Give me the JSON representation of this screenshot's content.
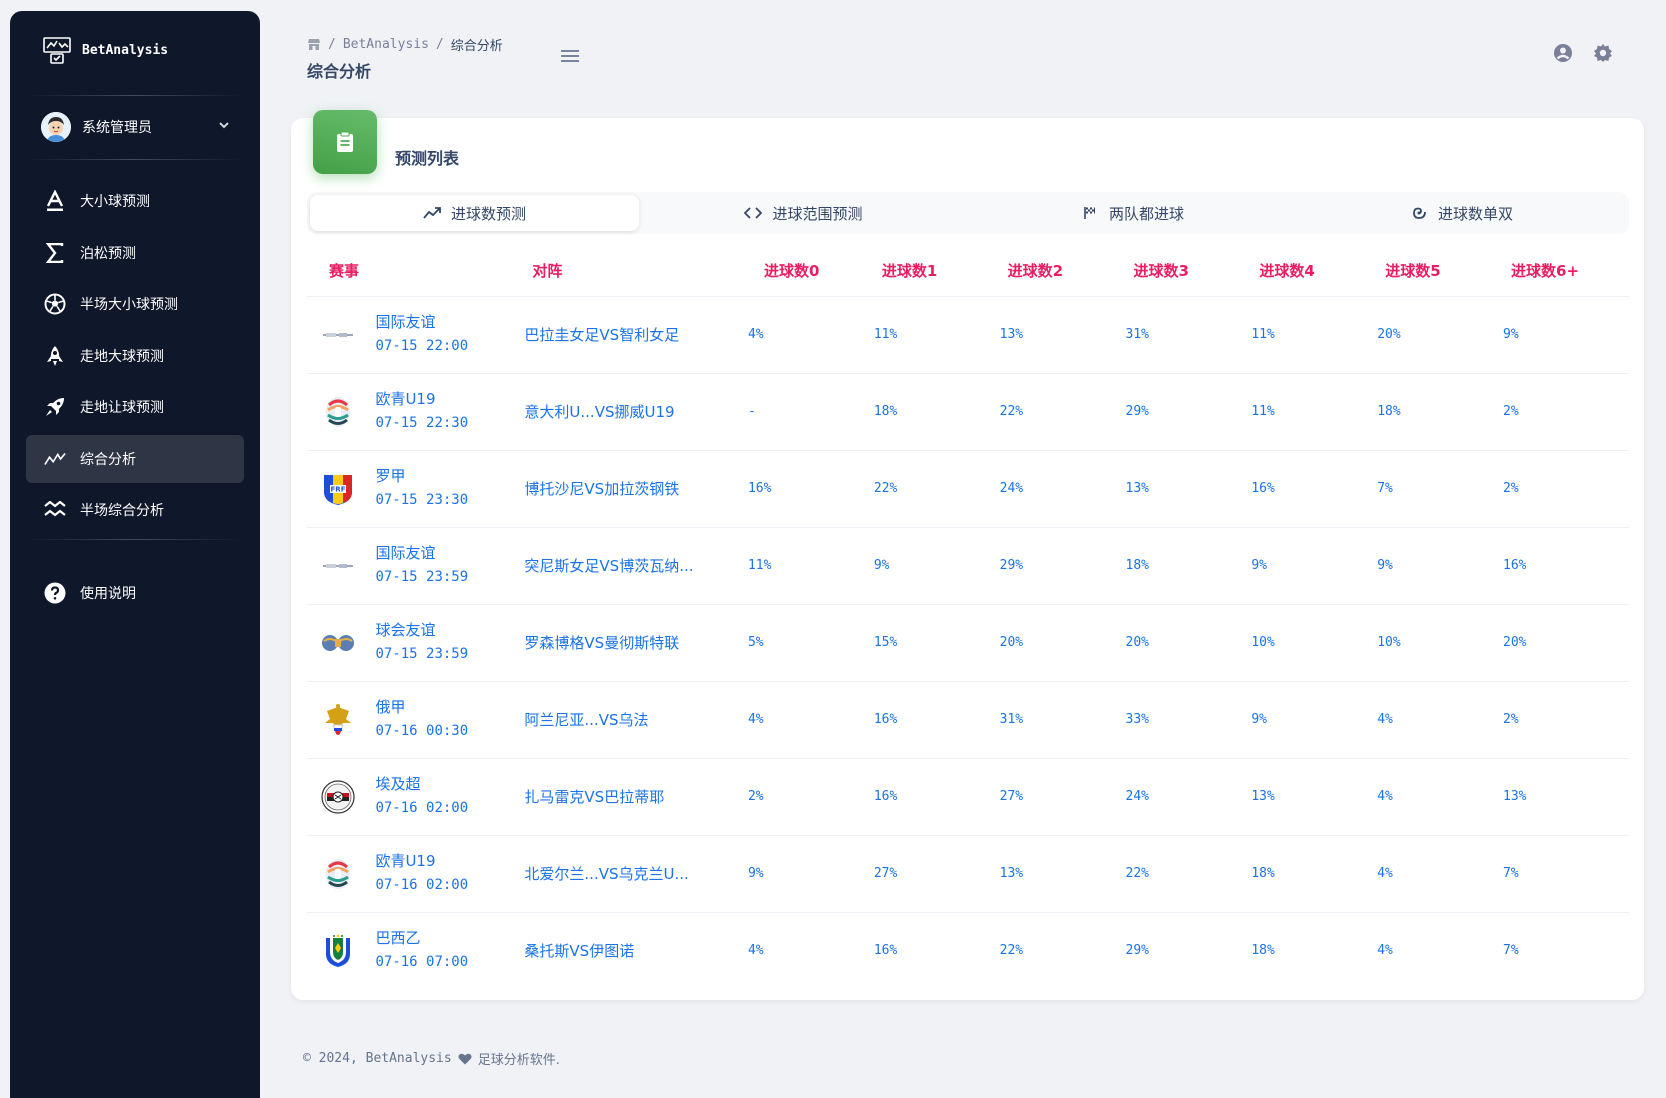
{
  "app": {
    "brand": "BetAnalysis"
  },
  "user": {
    "name": "系统管理员"
  },
  "sidebar": {
    "items": [
      {
        "label": "大小球预测",
        "icon": "letter-a-icon",
        "active": false
      },
      {
        "label": "泊松预测",
        "icon": "sigma-icon",
        "active": false
      },
      {
        "label": "半场大小球预测",
        "icon": "soccer-ball-icon",
        "active": false
      },
      {
        "label": "走地大球预测",
        "icon": "rocket-icon",
        "active": false
      },
      {
        "label": "走地让球预测",
        "icon": "rocket-launch-icon",
        "active": false
      },
      {
        "label": "综合分析",
        "icon": "trend-icon",
        "active": true
      },
      {
        "label": "半场综合分析",
        "icon": "waves-icon",
        "active": false
      }
    ],
    "help": {
      "label": "使用说明",
      "icon": "question-icon"
    }
  },
  "header": {
    "breadcrumb": {
      "root": "BetAnalysis",
      "current": "综合分析",
      "separator": "/"
    },
    "title": "综合分析"
  },
  "card": {
    "title": "预测列表",
    "tabs": [
      {
        "label": "进球数预测",
        "icon": "trend-icon",
        "active": true
      },
      {
        "label": "进球范围预测",
        "icon": "code-icon",
        "active": false
      },
      {
        "label": "两队都进球",
        "icon": "flag-icon",
        "active": false
      },
      {
        "label": "进球数单双",
        "icon": "spiral-icon",
        "active": false
      }
    ],
    "table": {
      "headers": [
        "赛事",
        "对阵",
        "进球数0",
        "进球数1",
        "进球数2",
        "进球数3",
        "进球数4",
        "进球数5",
        "进球数6+"
      ],
      "rows": [
        {
          "logo": "friendly-logo",
          "league": "国际友谊",
          "time": "07-15 22:00",
          "match": "巴拉圭女足VS智利女足",
          "p": [
            "4%",
            "11%",
            "13%",
            "31%",
            "11%",
            "20%",
            "9%"
          ]
        },
        {
          "logo": "euro-u19-logo",
          "league": "欧青U19",
          "time": "07-15 22:30",
          "match": "意大利U...VS挪威U19",
          "p": [
            "-",
            "18%",
            "22%",
            "29%",
            "11%",
            "18%",
            "2%"
          ]
        },
        {
          "logo": "romania-frf-logo",
          "league": "罗甲",
          "time": "07-15 23:30",
          "match": "博托沙尼VS加拉茨钢铁",
          "p": [
            "16%",
            "22%",
            "24%",
            "13%",
            "16%",
            "7%",
            "2%"
          ]
        },
        {
          "logo": "friendly-logo",
          "league": "国际友谊",
          "time": "07-15 23:59",
          "match": "突尼斯女足VS博茨瓦纳...",
          "p": [
            "11%",
            "9%",
            "29%",
            "18%",
            "9%",
            "9%",
            "16%"
          ]
        },
        {
          "logo": "club-friendly-logo",
          "league": "球会友谊",
          "time": "07-15 23:59",
          "match": "罗森博格VS曼彻斯特联",
          "p": [
            "5%",
            "15%",
            "20%",
            "20%",
            "10%",
            "10%",
            "20%"
          ]
        },
        {
          "logo": "russia-eagle-logo",
          "league": "俄甲",
          "time": "07-16 00:30",
          "match": "阿兰尼亚...VS乌法",
          "p": [
            "4%",
            "16%",
            "31%",
            "33%",
            "9%",
            "4%",
            "2%"
          ]
        },
        {
          "logo": "egypt-league-logo",
          "league": "埃及超",
          "time": "07-16 02:00",
          "match": "扎马雷克VS巴拉蒂耶",
          "p": [
            "2%",
            "16%",
            "27%",
            "24%",
            "13%",
            "4%",
            "13%"
          ]
        },
        {
          "logo": "euro-u19-logo",
          "league": "欧青U19",
          "time": "07-16 02:00",
          "match": "北爱尔兰...VS乌克兰U...",
          "p": [
            "9%",
            "27%",
            "13%",
            "22%",
            "18%",
            "4%",
            "7%"
          ]
        },
        {
          "logo": "brazil-cbf-logo",
          "league": "巴西乙",
          "time": "07-16 07:00",
          "match": "桑托斯VS伊图诺",
          "p": [
            "4%",
            "16%",
            "22%",
            "29%",
            "18%",
            "4%",
            "7%"
          ]
        }
      ]
    }
  },
  "footer": {
    "copyright": "© 2024, BetAnalysis",
    "suffix": "足球分析软件.",
    "icon": "heart-icon"
  },
  "colors": {
    "sidebar_bg": "#0f172a",
    "header_red": "#e91e63",
    "link_blue": "#1a73e8",
    "badge_green": "#4caf50"
  }
}
